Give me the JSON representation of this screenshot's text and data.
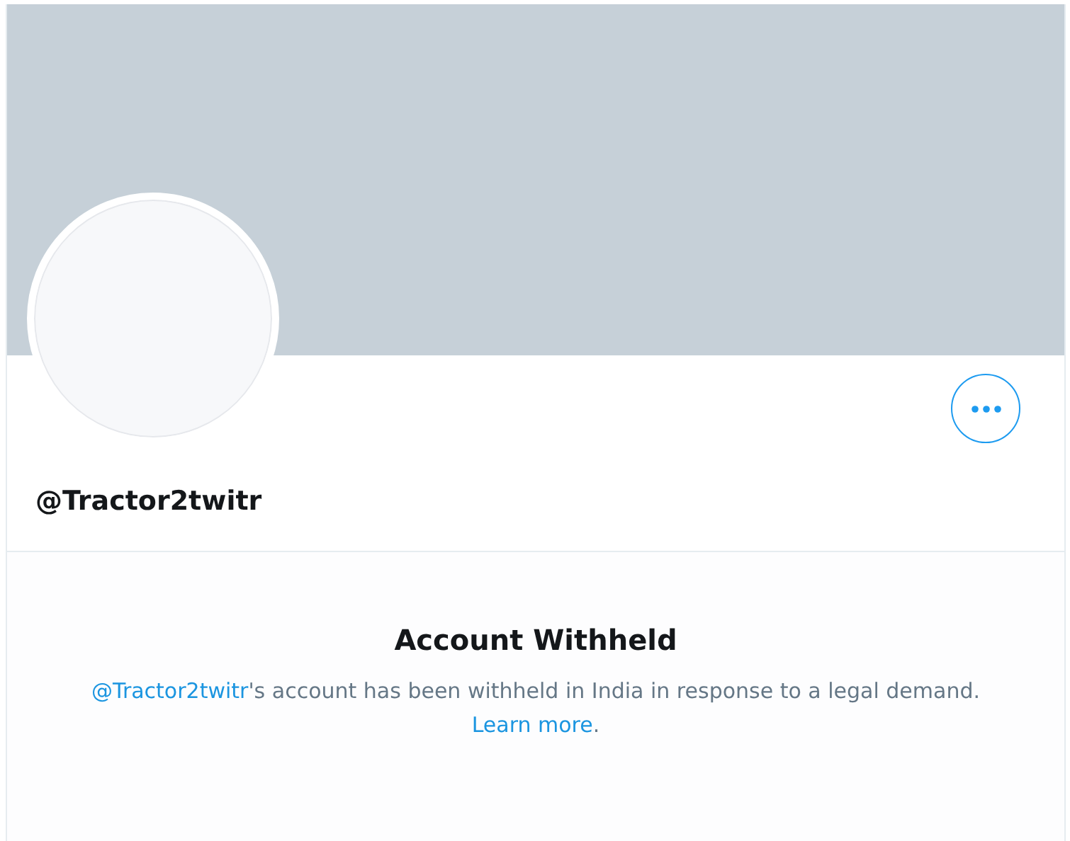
{
  "profile": {
    "handle": "@Tractor2twitr"
  },
  "notice": {
    "title": "Account Withheld",
    "mention": "@Tractor2twitr",
    "text": "'s account has been withheld in India in response to a legal demand.",
    "link": "Learn more",
    "end": "."
  }
}
